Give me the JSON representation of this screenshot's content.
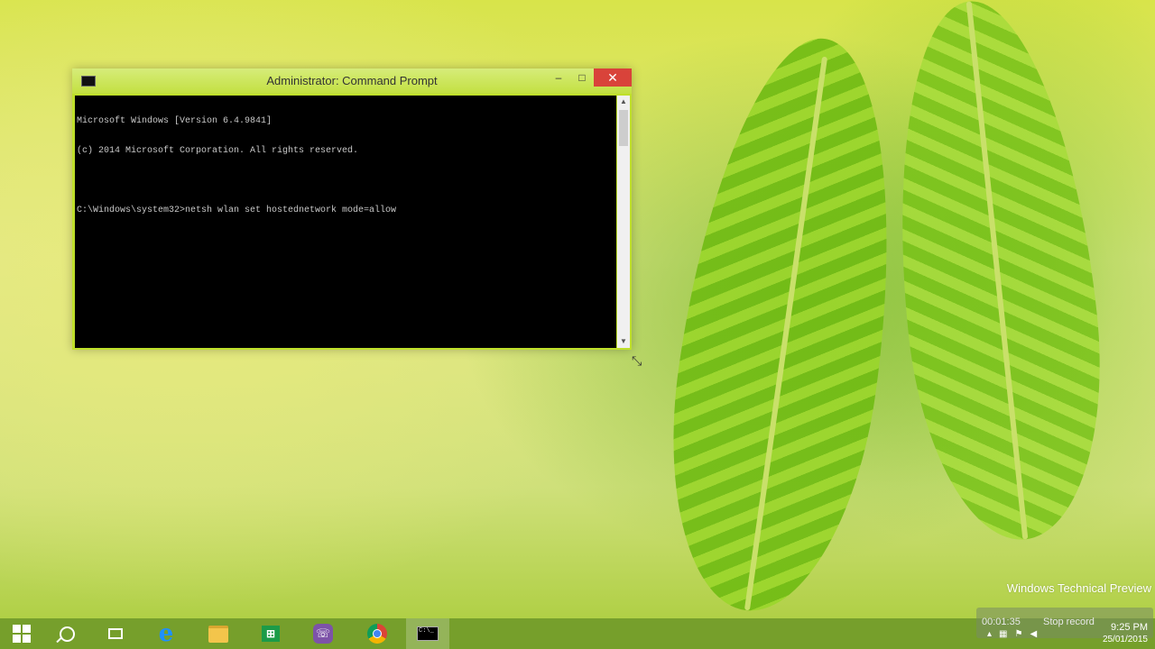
{
  "window": {
    "title": "Administrator: Command Prompt",
    "console_lines": [
      "Microsoft Windows [Version 6.4.9841]",
      "(c) 2014 Microsoft Corporation. All rights reserved.",
      "",
      "C:\\Windows\\system32>netsh wlan set hostednetwork mode=allow"
    ],
    "controls": {
      "minimize": "–",
      "maximize": "□",
      "close": "✕"
    }
  },
  "desktop": {
    "watermark": "Windows Technical Preview"
  },
  "recording": {
    "elapsed": "00:01:35",
    "stop_label": "Stop record"
  },
  "taskbar": {
    "apps": [
      {
        "name": "start",
        "icon": "windows-start-icon"
      },
      {
        "name": "search",
        "icon": "search-icon"
      },
      {
        "name": "task-view",
        "icon": "task-view-icon"
      },
      {
        "name": "internet-explorer",
        "icon": "internet-explorer-icon"
      },
      {
        "name": "file-explorer",
        "icon": "folder-icon"
      },
      {
        "name": "store",
        "icon": "store-icon"
      },
      {
        "name": "viber",
        "icon": "viber-icon"
      },
      {
        "name": "chrome",
        "icon": "chrome-icon"
      },
      {
        "name": "command-prompt",
        "icon": "command-prompt-icon",
        "active": true
      }
    ],
    "clock": {
      "time": "9:25 PM",
      "date": "25/01/2015"
    }
  }
}
